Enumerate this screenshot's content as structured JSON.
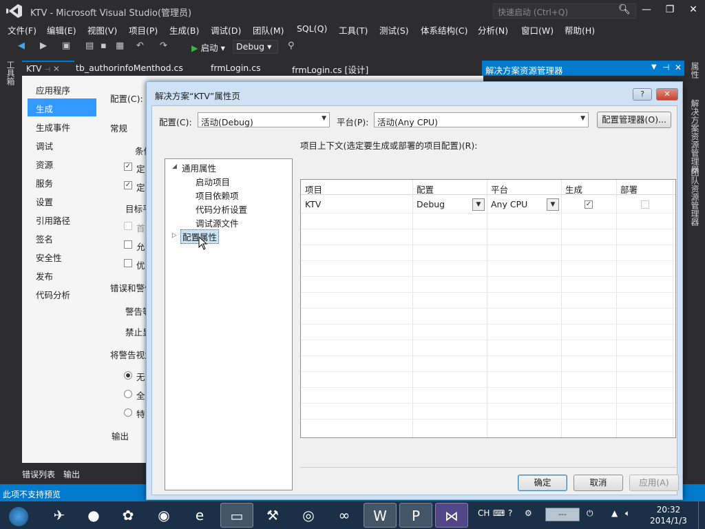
{
  "window": {
    "title": "KTV - Microsoft Visual Studio(管理员)",
    "quick_launch_placeholder": "快速启动 (Ctrl+Q)"
  },
  "menu": [
    "文件(F)",
    "编辑(E)",
    "视图(V)",
    "项目(P)",
    "生成(B)",
    "调试(D)",
    "团队(M)",
    "SQL(Q)",
    "工具(T)",
    "测试(S)",
    "体系结构(C)",
    "分析(N)",
    "窗口(W)",
    "帮助(H)"
  ],
  "toolbar": {
    "start_label": "启动",
    "config_value": "Debug"
  },
  "left_tool_tab": "工具箱",
  "doc_tabs": [
    "KTV",
    "tb_authorinfoMenthod.cs",
    "frmLogin.cs",
    "frmLogin.cs [设计]"
  ],
  "project_page": {
    "sidebar": [
      "应用程序",
      "生成",
      "生成事件",
      "调试",
      "资源",
      "服务",
      "设置",
      "引用路径",
      "签名",
      "安全性",
      "发布",
      "代码分析"
    ],
    "selected_sidebar": "生成",
    "config_label": "配置(C):",
    "section_general": "常规",
    "cond_label": "条件",
    "check1": "定",
    "check2": "定",
    "target_label": "目标平",
    "opt1": "首",
    "opt2": "允",
    "opt3": "优",
    "errors_section": "错误和警告",
    "warn_level": "警告等",
    "suppress": "禁止显",
    "treat_warnings": "将警告视为",
    "radio1": "无",
    "radio2": "全",
    "radio3": "特",
    "output_section": "输出"
  },
  "bottom_tabs": [
    "错误列表",
    "输出"
  ],
  "status_text": "此项不支持预览",
  "solution_explorer": {
    "title": "解决方案资源管理器"
  },
  "right_tabs": [
    "属性",
    "解决方案资源管理器",
    "团队资源管理器"
  ],
  "dialog": {
    "title": "解决方案“KTV”属性页",
    "help_label": "?",
    "config_label": "配置(C):",
    "config_value": "活动(Debug)",
    "platform_label": "平台(P):",
    "platform_value": "活动(Any CPU)",
    "config_manager": "配置管理器(O)...",
    "tree": {
      "common": "通用属性",
      "children": [
        "启动项目",
        "项目依赖项",
        "代码分析设置",
        "调试源文件"
      ],
      "config_props": "配置属性"
    },
    "grid_caption": "项目上下文(选定要生成或部署的项目配置)(R):",
    "columns": [
      "项目",
      "配置",
      "平台",
      "生成",
      "部署"
    ],
    "rows": [
      {
        "project": "KTV",
        "config": "Debug",
        "platform": "Any CPU",
        "build": true,
        "deploy": false
      }
    ],
    "ok": "确定",
    "cancel": "取消",
    "apply": "应用(A)"
  },
  "taskbar": {
    "tray_lang": "CH",
    "network": "---",
    "time": "20:32",
    "date": "2014/1/3"
  }
}
